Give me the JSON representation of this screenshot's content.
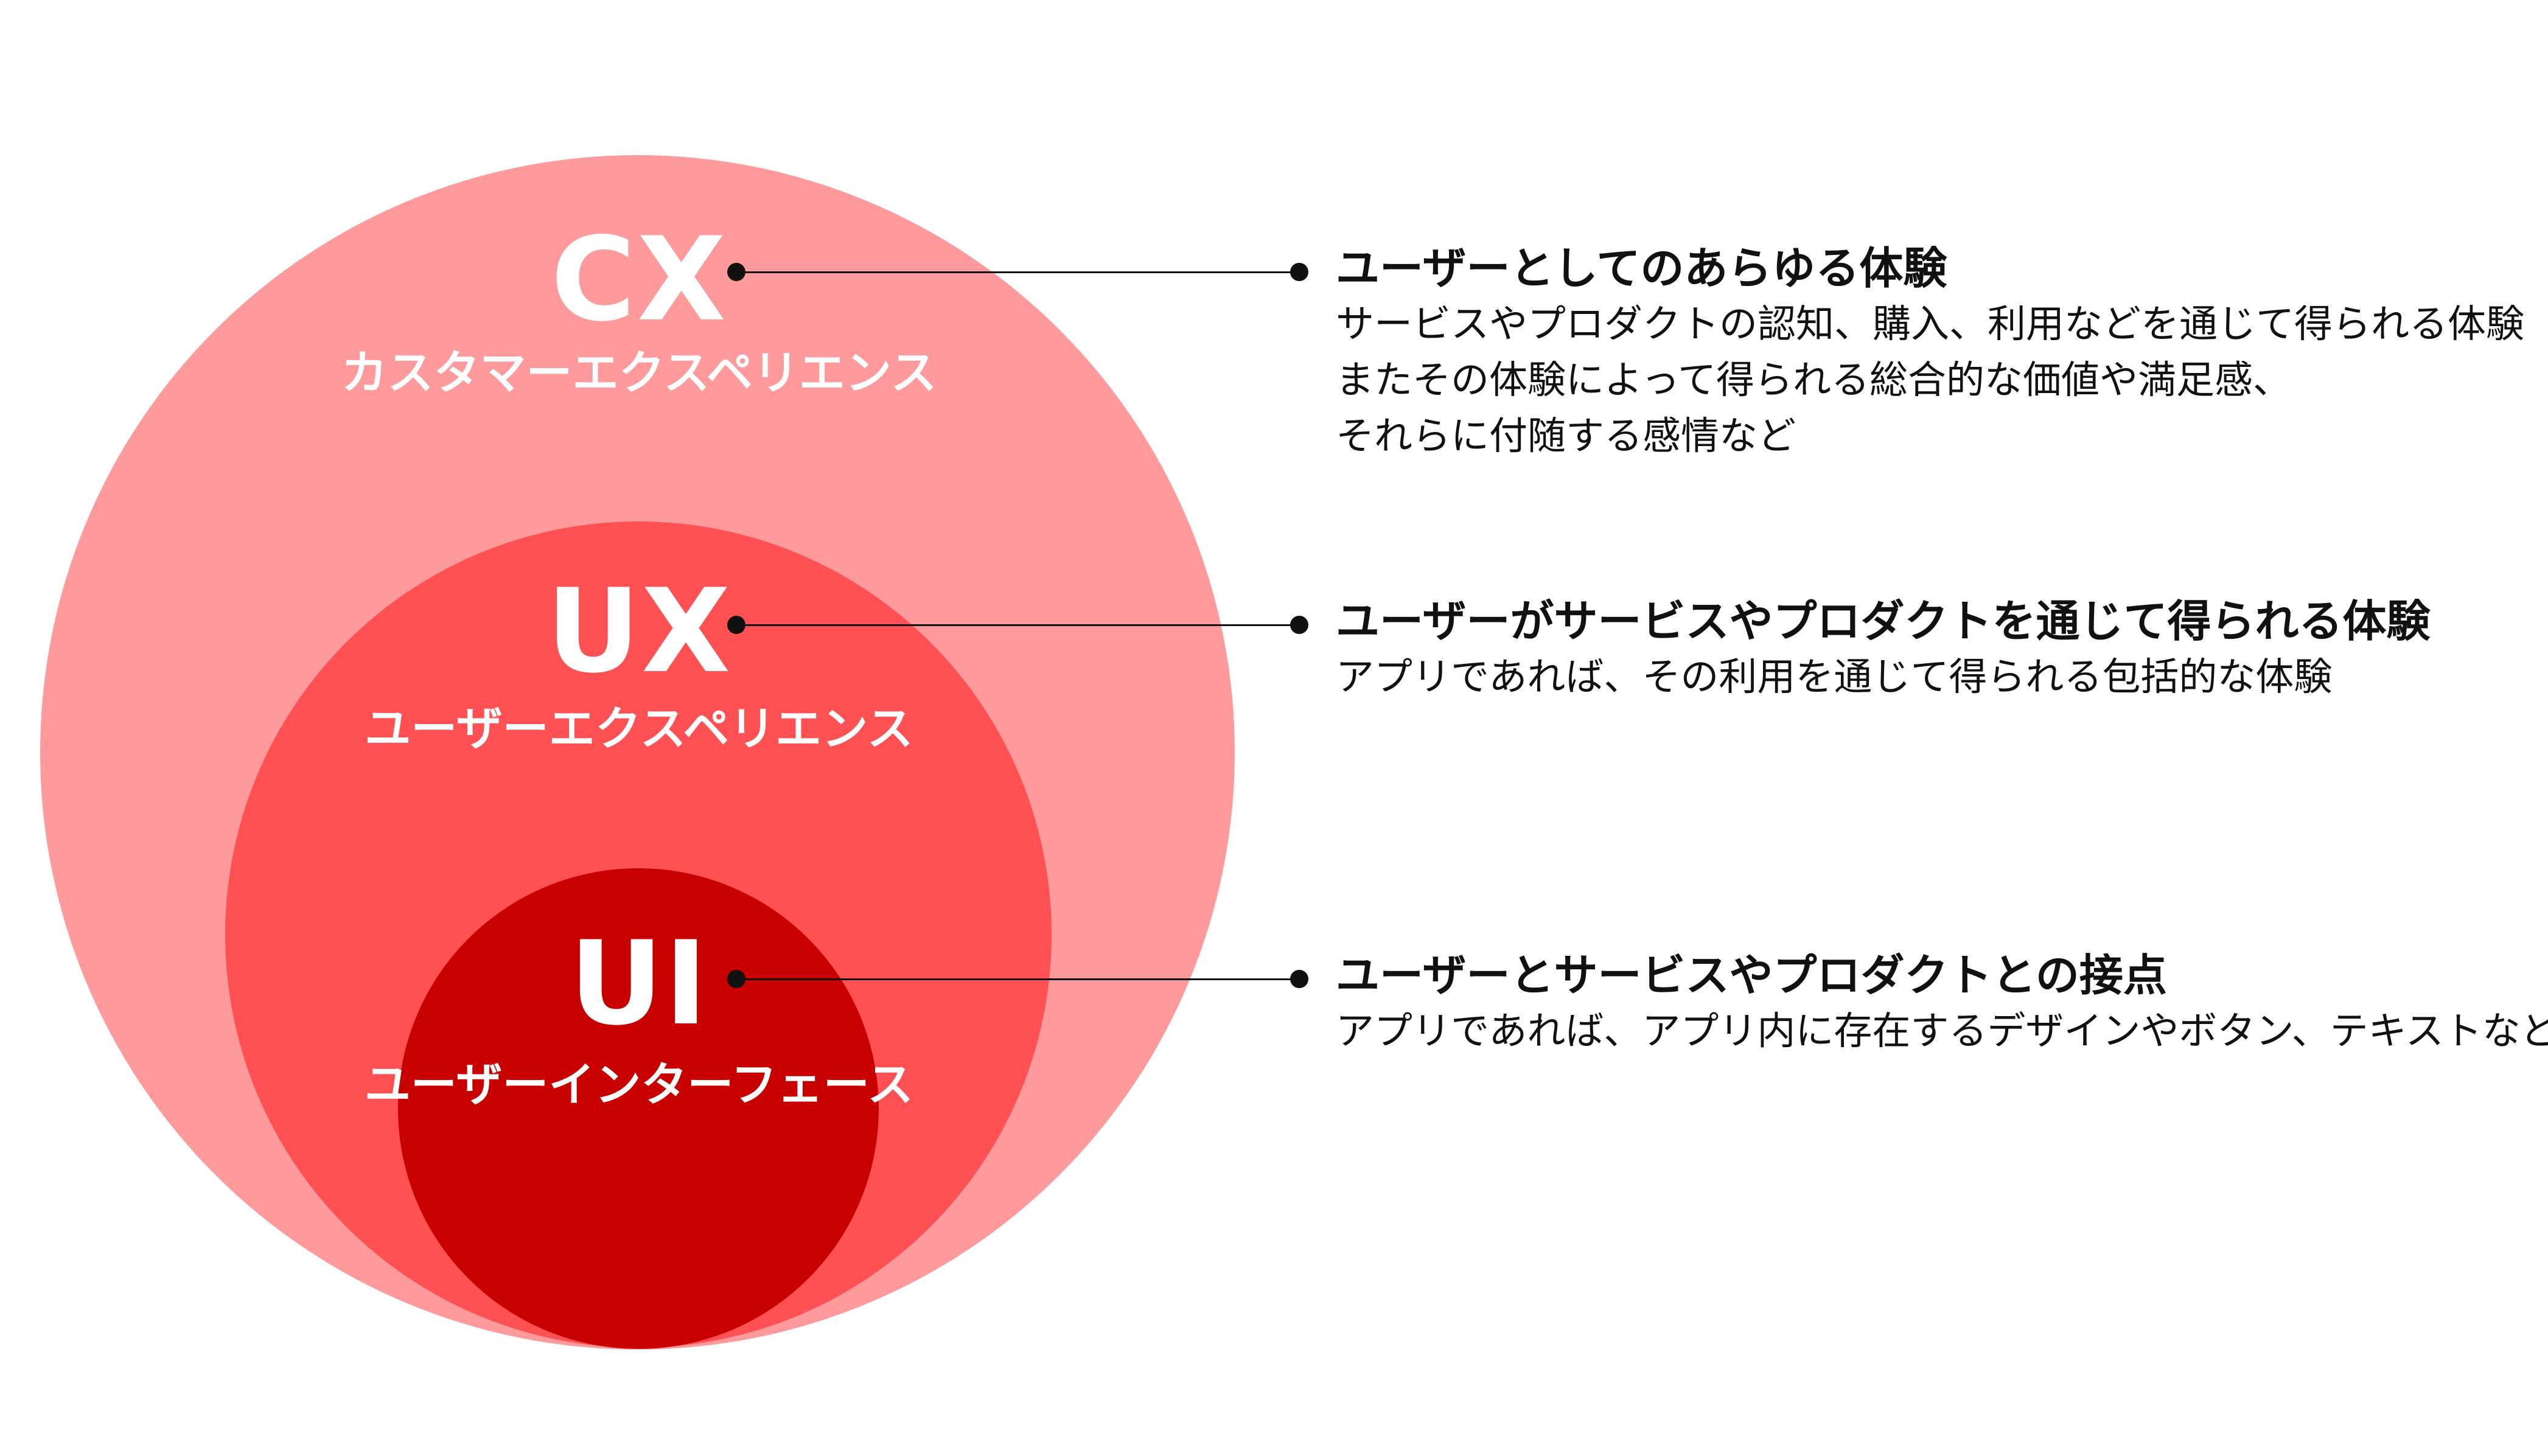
{
  "colors": {
    "cx_circle": "#ff9a9c",
    "ux_circle": "#ff5153",
    "ui_circle": "#c80000",
    "connector": "#111111",
    "label_text": "#ffffff",
    "desc_text": "#111111"
  },
  "layers": {
    "cx": {
      "title": "CX",
      "subtitle": "カスタマーエクスペリエンス"
    },
    "ux": {
      "title": "UX",
      "subtitle": "ユーザーエクスペリエンス"
    },
    "ui": {
      "title": "UI",
      "subtitle": "ユーザーインターフェース"
    }
  },
  "descriptions": {
    "cx": {
      "heading": "ユーザーとしてのあらゆる体験",
      "lines": [
        "サービスやプロダクトの認知、購入、利用などを通じて得られる体験",
        "またその体験によって得られる総合的な価値や満足感、",
        "それらに付随する感情など"
      ]
    },
    "ux": {
      "heading": "ユーザーがサービスやプロダクトを通じて得られる体験",
      "lines": [
        "アプリであれば、その利用を通じて得られる包括的な体験"
      ]
    },
    "ui": {
      "heading": "ユーザーとサービスやプロダクトとの接点",
      "lines": [
        "アプリであれば、アプリ内に存在するデザインやボタン、テキストなど"
      ]
    }
  }
}
